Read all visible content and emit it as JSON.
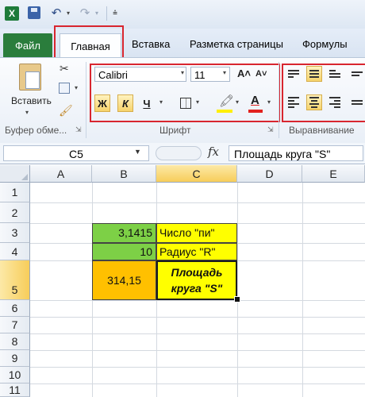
{
  "qat": {
    "app_icon": "X",
    "save_icon": "save-icon",
    "undo_icon": "↶",
    "redo_icon": "↷",
    "dropdown_glyph": "▾",
    "customize_glyph": "⩮"
  },
  "tabs": {
    "file": "Файл",
    "home": "Главная",
    "insert": "Вставка",
    "page_layout": "Разметка страницы",
    "formulas": "Формулы"
  },
  "ribbon": {
    "clipboard": {
      "paste_label": "Вставить",
      "group_label": "Буфер обме...",
      "cut_glyph": "✂",
      "painter_glyph": "🖌"
    },
    "font": {
      "font_name": "Calibri",
      "font_size": "11",
      "grow_glyph": "A˄",
      "shrink_glyph": "A˅",
      "bold": "Ж",
      "italic": "К",
      "underline": "Ч",
      "fill_glyph": "🖍",
      "font_color_glyph": "A",
      "group_label": "Шрифт",
      "launcher_glyph": "⇲"
    },
    "alignment": {
      "group_label": "Выравнивание"
    },
    "accent_colors": {
      "highlight": "#d8262f",
      "fill_color": "#ffef00",
      "font_color": "#e2221f"
    }
  },
  "formula_bar": {
    "name_box": "C5",
    "fx": "fx",
    "formula": "Площадь круга \"S\""
  },
  "grid": {
    "columns": [
      "A",
      "B",
      "C",
      "D",
      "E"
    ],
    "rows": [
      "1",
      "2",
      "3",
      "4",
      "5",
      "6",
      "7",
      "8",
      "9",
      "10",
      "11"
    ],
    "selected_cell": "C5"
  },
  "cells": {
    "B3": "3,1415",
    "C3": "Число \"пи\"",
    "B4": "10",
    "C4": "Радиус \"R\"",
    "B5": "314,15",
    "C5": "Площадь круга \"S\""
  },
  "cell_colors": {
    "green": "#7dd046",
    "yellow": "#ffff00",
    "orange": "#ffc000"
  }
}
